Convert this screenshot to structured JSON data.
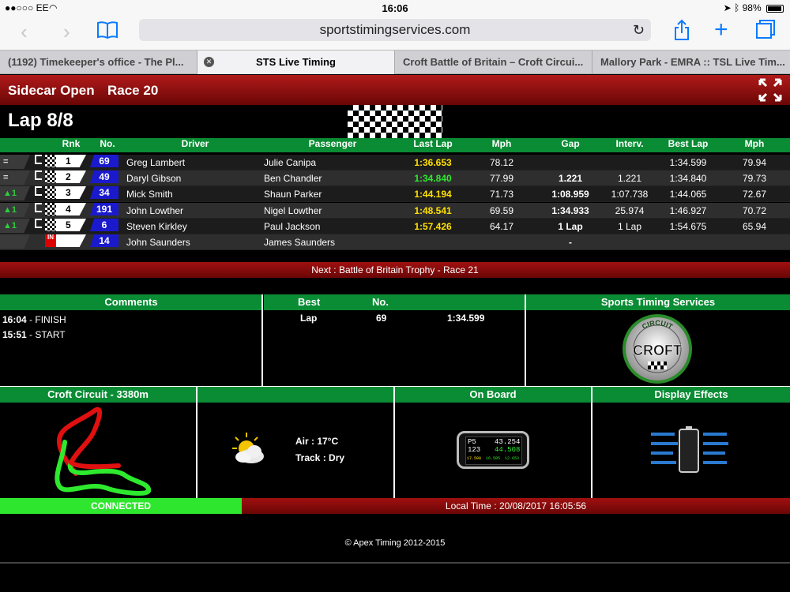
{
  "status": {
    "carrier": "●●○○○ EE",
    "time": "16:06",
    "battery": "98%"
  },
  "browser": {
    "url": "sportstimingservices.com",
    "tabs": [
      "(1192) Timekeeper's office - The Pl...",
      "STS Live Timing",
      "Croft Battle of Britain – Croft Circui...",
      "Mallory Park - EMRA :: TSL Live Tim..."
    ]
  },
  "header": {
    "class": "Sidecar Open",
    "race": "Race 20",
    "lap": "Lap 8/8"
  },
  "columns": {
    "rnk": "Rnk",
    "no": "No.",
    "driver": "Driver",
    "passenger": "Passenger",
    "last_lap": "Last Lap",
    "mph": "Mph",
    "gap": "Gap",
    "interv": "Interv.",
    "best_lap": "Best Lap",
    "mph2": "Mph"
  },
  "rows": [
    {
      "trend": "=",
      "rnk": "1",
      "no": "69",
      "driver": "Greg Lambert",
      "passenger": "Julie Canipa",
      "last": "1:36.653",
      "mph": "78.12",
      "gap": "",
      "interv": "",
      "best": "1:34.599",
      "bmph": "79.94"
    },
    {
      "trend": "=",
      "rnk": "2",
      "no": "49",
      "driver": "Daryl Gibson",
      "passenger": "Ben Chandler",
      "last": "1:34.840",
      "mph": "77.99",
      "gap": "1.221",
      "interv": "1.221",
      "best": "1:34.840",
      "bmph": "79.73"
    },
    {
      "trend": "▲1",
      "rnk": "3",
      "no": "34",
      "driver": "Mick Smith",
      "passenger": "Shaun Parker",
      "last": "1:44.194",
      "mph": "71.73",
      "gap": "1:08.959",
      "interv": "1:07.738",
      "best": "1:44.065",
      "bmph": "72.67"
    },
    {
      "trend": "▲1",
      "rnk": "4",
      "no": "191",
      "driver": "John Lowther",
      "passenger": "Nigel Lowther",
      "last": "1:48.541",
      "mph": "69.59",
      "gap": "1:34.933",
      "interv": "25.974",
      "best": "1:46.927",
      "bmph": "70.72"
    },
    {
      "trend": "▲1",
      "rnk": "5",
      "no": "6",
      "driver": "Steven Kirkley",
      "passenger": "Paul Jackson",
      "last": "1:57.426",
      "mph": "64.17",
      "gap": "1 Lap",
      "interv": "1 Lap",
      "best": "1:54.675",
      "bmph": "65.94"
    },
    {
      "trend": "",
      "rnk": "",
      "pit": "IN",
      "no": "14",
      "driver": "John Saunders",
      "passenger": "James Saunders",
      "last": "",
      "mph": "",
      "gap": "-",
      "interv": "",
      "best": "",
      "bmph": ""
    }
  ],
  "next": "Next : Battle of Britain Trophy - Race 21",
  "comments": {
    "title": "Comments",
    "items": [
      {
        "time": "16:04",
        "text": " - FINISH"
      },
      {
        "time": "15:51",
        "text": " - START"
      }
    ]
  },
  "best": {
    "title": "Best",
    "no_label": "No.",
    "kind": "Lap",
    "no": "69",
    "time": "1:34.599"
  },
  "sts": {
    "title": "Sports Timing Services",
    "logo_text": "CROFT",
    "logo_arc": "CIRCUIT"
  },
  "circuit": {
    "title": "Croft Circuit - 3380m"
  },
  "weather": {
    "air": "Air : 17°C",
    "track": "Track : Dry"
  },
  "onboard": {
    "title": "On Board",
    "pos": "P5",
    "time1": "43.254",
    "lap": "123",
    "time2": "44.508",
    "s1": "17.500",
    "s2": "16.505",
    "s3": "12.653"
  },
  "effects": {
    "title": "Display Effects"
  },
  "connection": "CONNECTED",
  "local_time": "Local Time : 20/08/2017 16:05:56",
  "footer": "© Apex Timing 2012-2015",
  "colors": {
    "green": "#0a8c34",
    "red": "#8a0a0a",
    "yellow": "#ffe000"
  }
}
